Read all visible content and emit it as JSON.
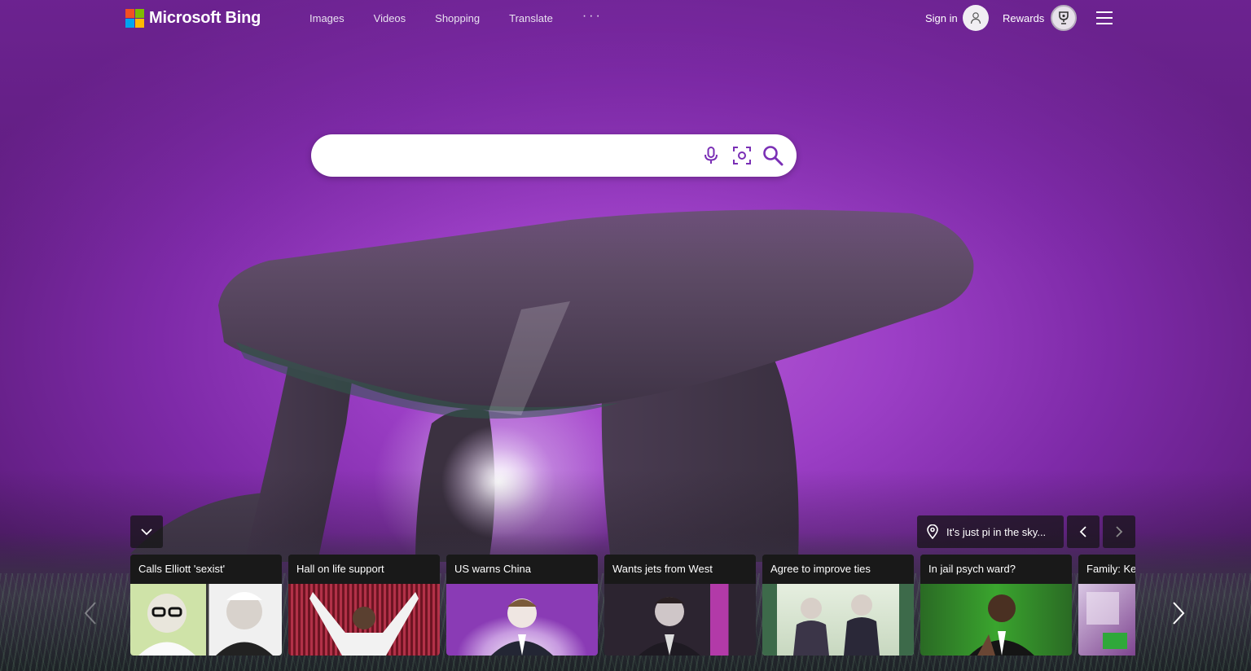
{
  "header": {
    "logo_text": "Microsoft Bing",
    "logo_colors": [
      "#f25022",
      "#7fba00",
      "#00a4ef",
      "#ffb900"
    ],
    "nav": [
      "Images",
      "Videos",
      "Shopping",
      "Translate"
    ],
    "more_label": "···",
    "sign_in_label": "Sign in",
    "rewards_label": "Rewards"
  },
  "search": {
    "value": "",
    "placeholder": "",
    "icons": [
      "microphone-icon",
      "visual-search-icon",
      "search-icon"
    ],
    "accent": "#7a2fb5"
  },
  "image_info": {
    "location_text": "It's just pi in the sky...",
    "icons": [
      "location-pin-icon",
      "chevron-left-icon",
      "chevron-right-icon"
    ]
  },
  "news": [
    {
      "caption": "Calls Elliott 'sexist'",
      "colors": [
        "#cfe3a8",
        "#f4f4f4"
      ]
    },
    {
      "caption": "Hall on life support",
      "colors": [
        "#7a1a2a",
        "#e8e8e8"
      ]
    },
    {
      "caption": "US warns China",
      "colors": [
        "#8a3bb5",
        "#f2e8f6"
      ]
    },
    {
      "caption": "Wants jets from West",
      "colors": [
        "#2c2430",
        "#b23aa8"
      ]
    },
    {
      "caption": "Agree to improve ties",
      "colors": [
        "#d9e6d0",
        "#3b3548"
      ]
    },
    {
      "caption": "In jail psych ward?",
      "colors": [
        "#2f7a2a",
        "#3aa52e"
      ]
    },
    {
      "caption": "Family: Ke",
      "colors": [
        "#7a3f8c",
        "#2fa83a"
      ]
    }
  ]
}
